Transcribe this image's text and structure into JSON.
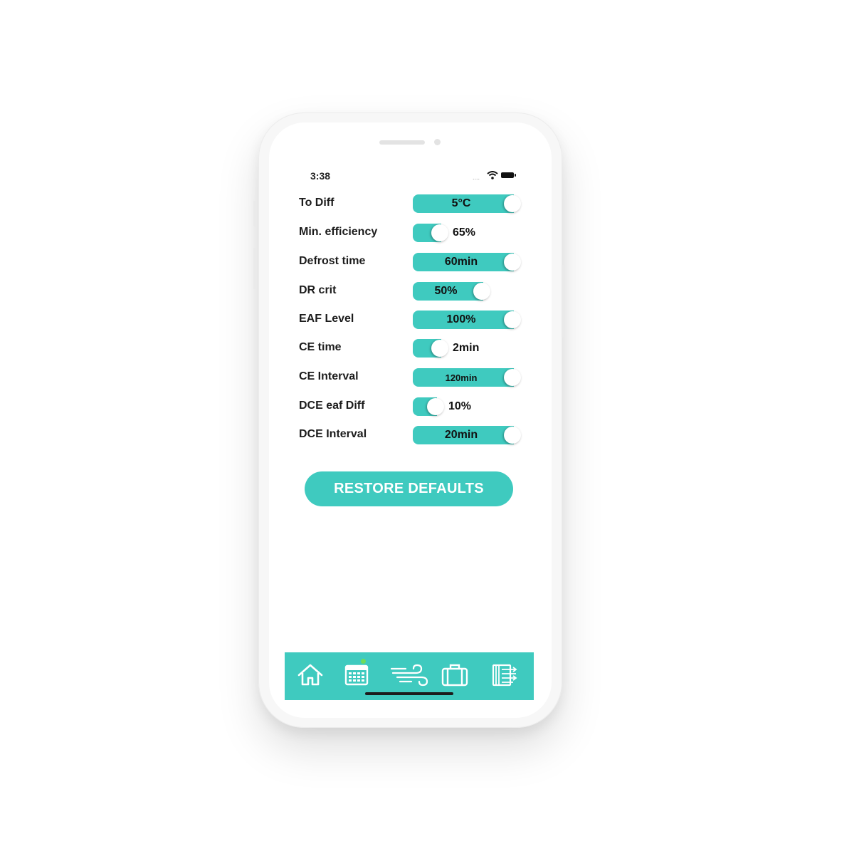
{
  "status_bar": {
    "time": "3:38",
    "signal": "....",
    "wifi_icon": "wifi-icon",
    "battery_icon": "battery-icon"
  },
  "colors": {
    "accent": "#3fcabf",
    "text": "#1c1c1c",
    "badge": "#6fdc5a"
  },
  "settings": [
    {
      "label": "To Diff",
      "value": "5°C",
      "level": 1.0
    },
    {
      "label": "Min. efficiency",
      "value": "65%",
      "level": 0.28
    },
    {
      "label": "Defrost time",
      "value": "60min",
      "level": 1.0
    },
    {
      "label": "DR crit",
      "value": "50%",
      "level": 0.7
    },
    {
      "label": "EAF Level",
      "value": "100%",
      "level": 1.0
    },
    {
      "label": "CE time",
      "value": "2min",
      "level": 0.28
    },
    {
      "label": "CE Interval",
      "value": "120min",
      "level": 1.0
    },
    {
      "label": "DCE eaf Diff",
      "value": "10%",
      "level": 0.24
    },
    {
      "label": "DCE Interval",
      "value": "20min",
      "level": 1.0
    }
  ],
  "restore_button": {
    "label": "RESTORE DEFAULTS"
  },
  "tabbar": {
    "items": [
      {
        "icon": "home-icon"
      },
      {
        "icon": "calendar-icon",
        "badge": true
      },
      {
        "icon": "wind-icon"
      },
      {
        "icon": "suitcase-icon"
      },
      {
        "icon": "filter-icon"
      }
    ]
  }
}
